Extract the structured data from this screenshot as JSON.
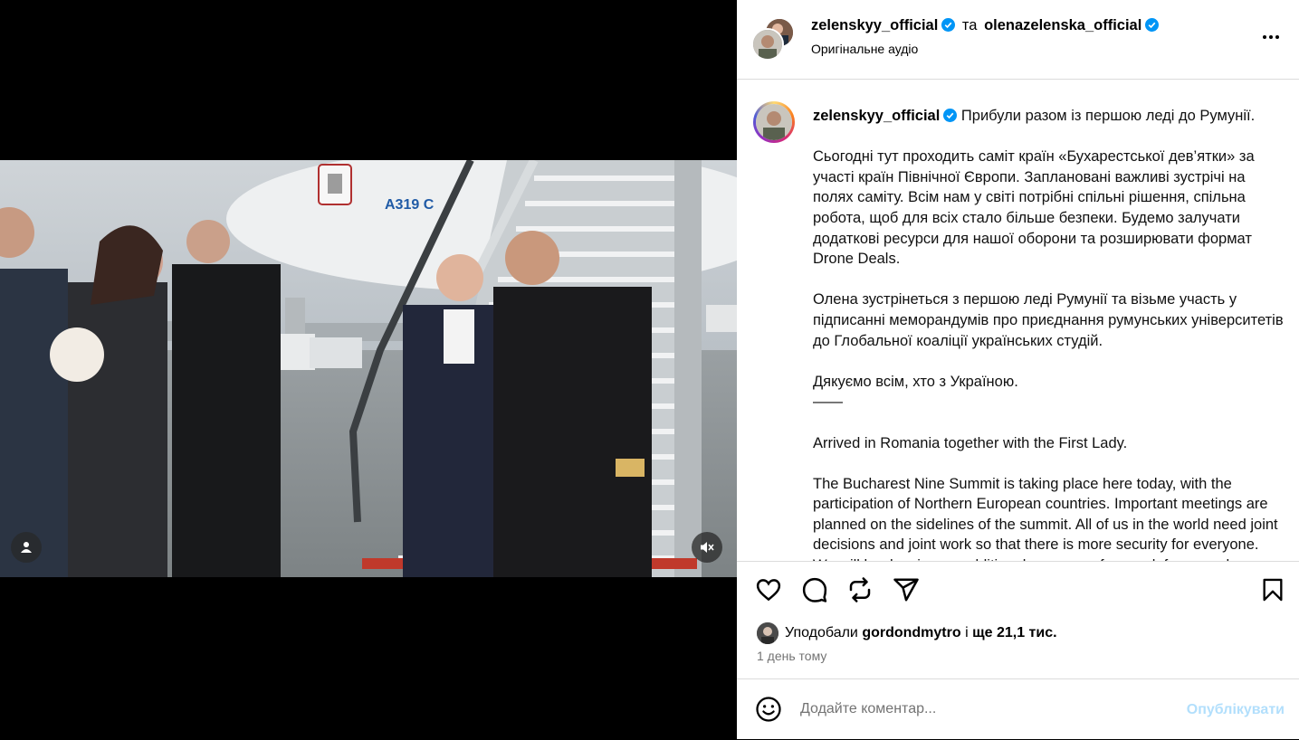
{
  "post": {
    "author": "zelenskyy_official",
    "connector": "та",
    "coauthor": "olenazelenska_official",
    "audio": "Оригінальне аудіо"
  },
  "caption": {
    "author": "zelenskyy_official",
    "paragraphs": [
      "Прибули разом із першою леді до Румунії.",
      "Сьогодні тут проходить саміт країн «Бухарестської дев’ятки» за участі країн Північної Європи. Заплановані важливі зустрічі на полях саміту. Всім нам у світі потрібні спільні рішення, спільна робота, щоб для всіх стало більше безпеки. Будемо залучати додаткові ресурси для нашої оборони та розширювати формат Drone Deals.",
      "Олена зустрінеться з першою леді Румунії та візьме участь у підписанні меморандумів про приєднання румунських університетів до Глобальної коаліції українських студій.",
      "Дякуємо всім, хто з Україною.",
      "——",
      "Arrived in Romania together with the First Lady.",
      "The Bucharest Nine Summit is taking place here today, with the participation of Northern European countries. Important meetings are planned on the sidelines of the summit. All of us in the world need joint decisions and joint work so that there is more security for everyone. We will be drawing on additional resources for our defense and expanding the Drone Deals format."
    ]
  },
  "likes": {
    "prefix": "Уподобали",
    "user": "gordondmytro",
    "middle": "і",
    "count": "ще 21,1 тис."
  },
  "timestamp": "1 день тому",
  "comment": {
    "placeholder": "Додайте коментар...",
    "publish": "Опублікувати"
  },
  "media": {
    "plane_label": "A319 C"
  },
  "colors": {
    "verified": "#0095f6",
    "publish_disabled": "#b2dffc",
    "muted_text": "#737373"
  }
}
